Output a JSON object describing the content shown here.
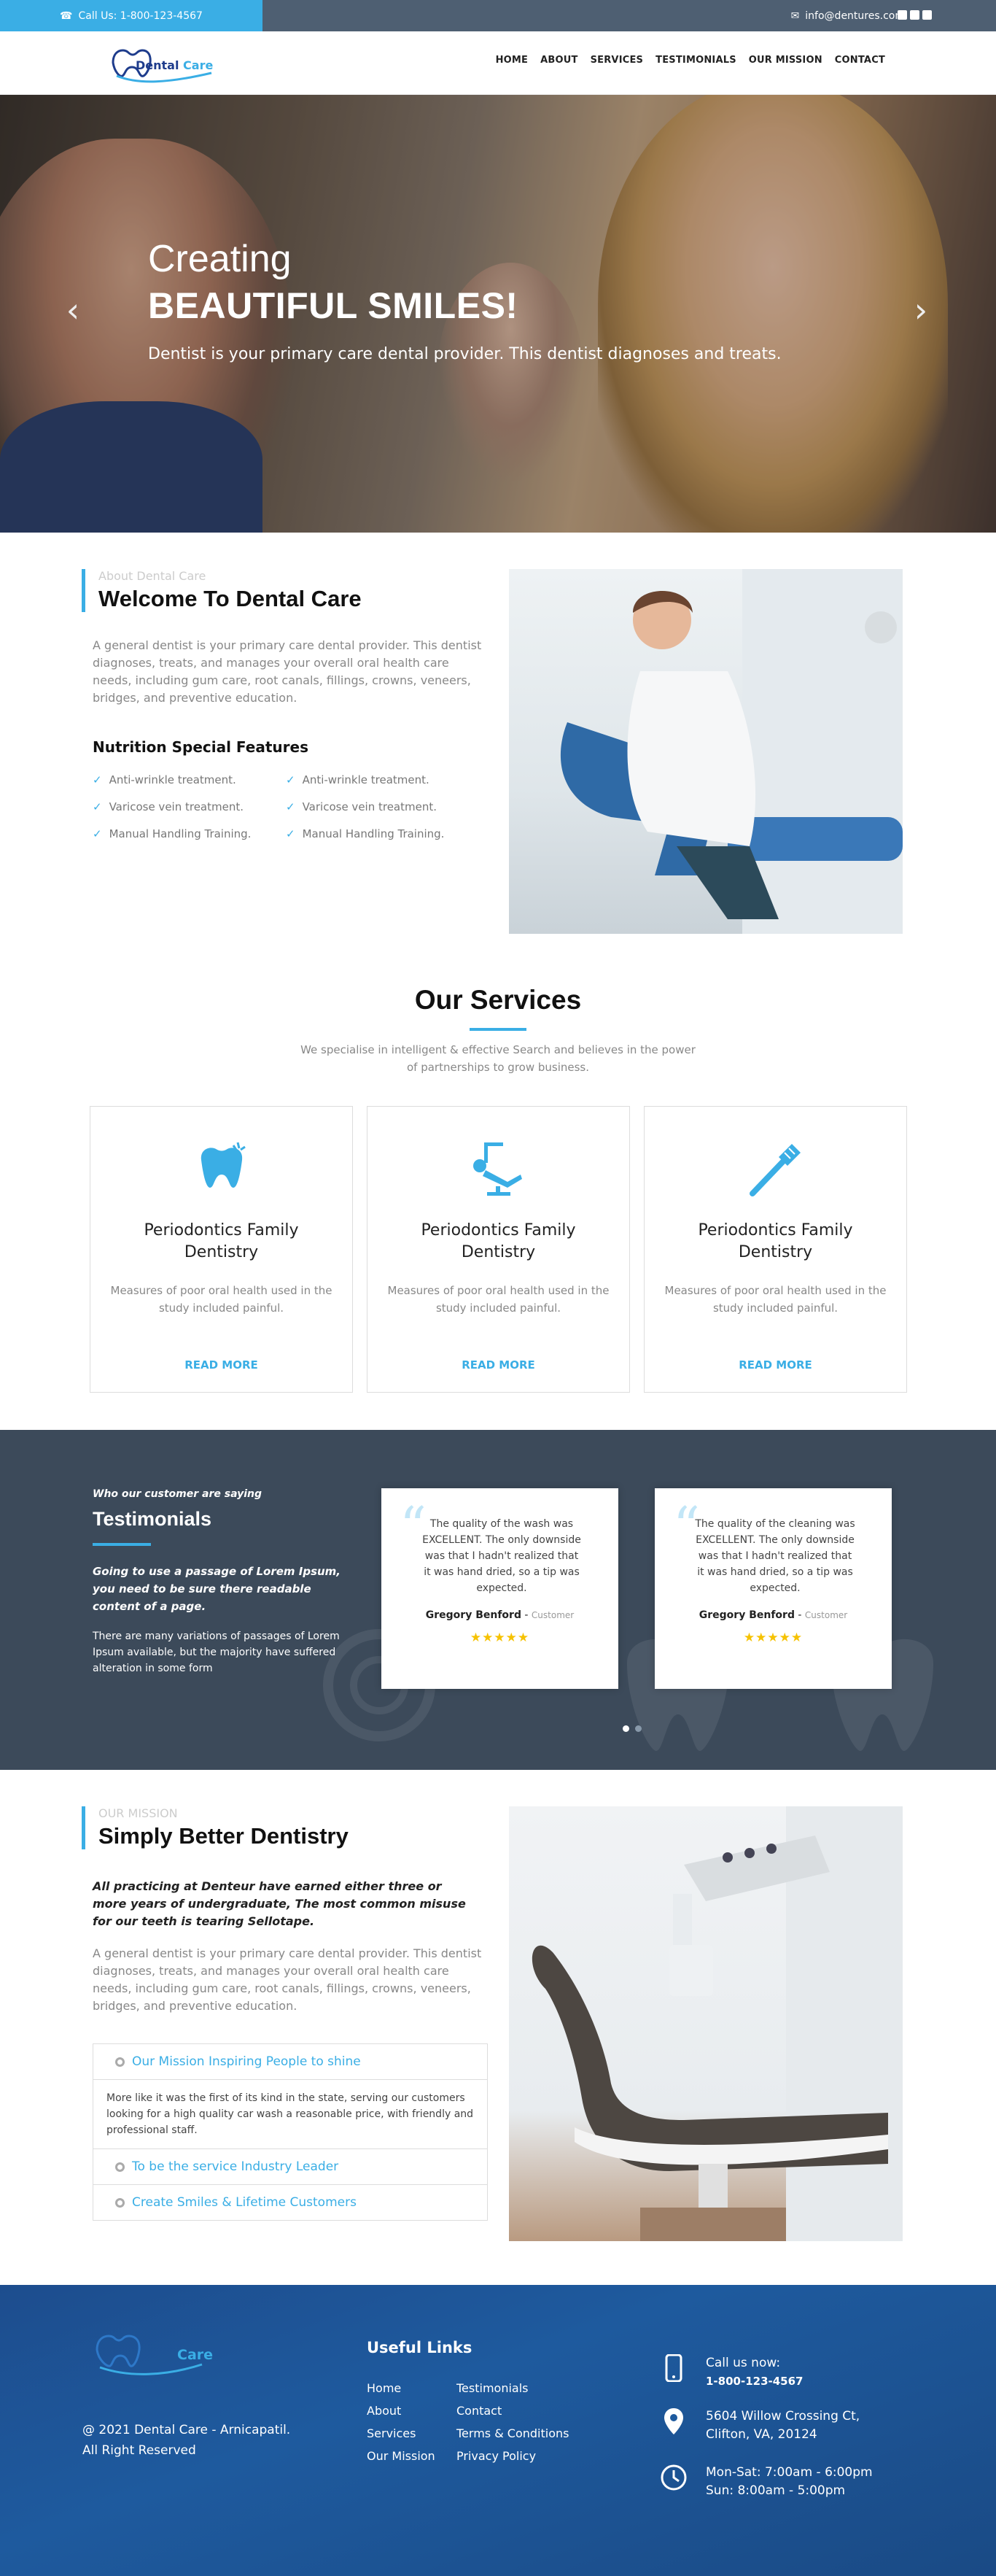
{
  "topbar": {
    "call": "Call Us: 1-800-123-4567",
    "email": "info@dentures.com"
  },
  "logo": {
    "name_part1": "Dental",
    "name_part2": "Care"
  },
  "nav": [
    "HOME",
    "ABOUT",
    "SERVICES",
    "TESTIMONIALS",
    "OUR MISSION",
    "CONTACT"
  ],
  "hero": {
    "line1": "Creating",
    "line2": "BEAUTIFUL SMILES!",
    "subtitle": "Dentist is your primary care dental provider. This dentist diagnoses and treats."
  },
  "about": {
    "tag": "About Dental Care",
    "title": "Welcome To Dental Care",
    "body": "A general dentist is your primary care dental provider. This dentist diagnoses, treats, and manages your overall oral health care needs, including gum care, root canals, fillings, crowns, veneers, bridges, and preventive education.",
    "features_title": "Nutrition Special Features",
    "features": [
      "Anti-wrinkle treatment.",
      "Anti-wrinkle treatment.",
      "Varicose vein treatment.",
      "Varicose vein treatment.",
      "Manual Handling Training.",
      "Manual Handling Training."
    ]
  },
  "services": {
    "title": "Our Services",
    "subtitle": "We specialise in intelligent & effective Search and believes in the power of partnerships to grow business.",
    "cards": [
      {
        "icon": "tooth-icon",
        "title": "Periodontics Family Dentistry",
        "text": "Measures of poor oral health used in the study included painful.",
        "link": "READ MORE"
      },
      {
        "icon": "dental-chair-icon",
        "title": "Periodontics Family Dentistry",
        "text": "Measures of poor oral health used in the study included painful.",
        "link": "READ MORE"
      },
      {
        "icon": "toothbrush-icon",
        "title": "Periodontics Family Dentistry",
        "text": "Measures of poor oral health used in the study included painful.",
        "link": "READ MORE"
      }
    ]
  },
  "testimonials": {
    "tag": "Who our customer are saying",
    "title": "Testimonials",
    "lead": "Going to use a passage of Lorem Ipsum, you need to be sure there readable content of a page.",
    "body": "There are many variations of passages of Lorem Ipsum available, but the majority have suffered alteration in some form",
    "items": [
      {
        "text": "The quality of the wash was EXCELLENT. The only downside was that I hadn't realized that it was hand dried, so a tip was expected.",
        "name": "Gregory Benford",
        "role": "Customer",
        "stars": "★★★★★"
      },
      {
        "text": "The quality of the cleaning was EXCELLENT. The only downside was that I hadn't realized that it was hand dried, so a tip was expected.",
        "name": "Gregory Benford",
        "role": "Customer",
        "stars": "★★★★★"
      }
    ]
  },
  "mission": {
    "tag": "OUR MISSION",
    "title": "Simply Better Dentistry",
    "lead": "All practicing at Denteur have earned either three or more years of undergraduate, The most common misuse for our teeth is tearing Sellotape.",
    "body": "A general dentist is your primary care dental provider. This dentist diagnoses, treats, and manages your overall oral health care needs, including gum care, root canals, fillings, crowns, veneers, bridges, and preventive education.",
    "accordion": [
      {
        "title": "Our Mission Inspiring People to shine",
        "content": "More like it was the first of its kind in the state, serving our customers looking for a high quality car wash a reasonable price, with friendly and professional staff."
      },
      {
        "title": "To be the service Industry Leader"
      },
      {
        "title": "Create Smiles & Lifetime Customers"
      }
    ]
  },
  "footer": {
    "logo_part2": "Care",
    "copyright_line1": "@ 2021 Dental Care - Arnicapatil.",
    "copyright_line2": "All Right Reserved",
    "links_title": "Useful Links",
    "links": [
      "Home",
      "Testimonials",
      "About",
      "Contact",
      "Services",
      "Terms & Conditions",
      "Our Mission",
      "Privacy Policy"
    ],
    "call_label": "Call us now:",
    "phone": "1-800-123-4567",
    "address_line1": "5604 Willow Crossing Ct,",
    "address_line2": "Clifton, VA, 20124",
    "hours_line1": "Mon-Sat: 7:00am - 6:00pm",
    "hours_line2": "Sun: 8:00am - 5:00pm"
  },
  "colors": {
    "accent": "#3aaee5",
    "topbar": "#4e5f72",
    "testimonials_bg": "#3c4a5a",
    "footer_bg": "#1e5a9e",
    "stars": "#f6c200"
  }
}
